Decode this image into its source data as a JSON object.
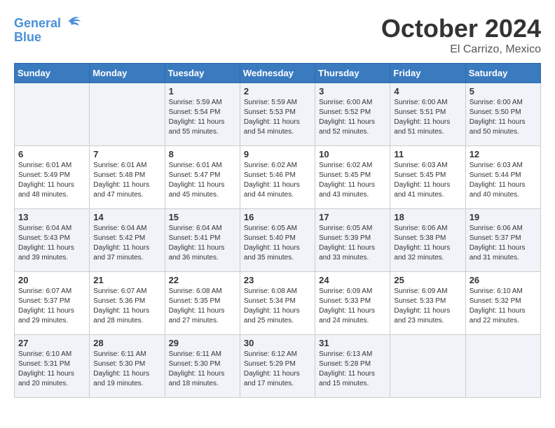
{
  "header": {
    "logo_line1": "General",
    "logo_line2": "Blue",
    "title": "October 2024",
    "subtitle": "El Carrizo, Mexico"
  },
  "days_of_week": [
    "Sunday",
    "Monday",
    "Tuesday",
    "Wednesday",
    "Thursday",
    "Friday",
    "Saturday"
  ],
  "weeks": [
    [
      {
        "day": "",
        "info": ""
      },
      {
        "day": "",
        "info": ""
      },
      {
        "day": "1",
        "info": "Sunrise: 5:59 AM\nSunset: 5:54 PM\nDaylight: 11 hours and 55 minutes."
      },
      {
        "day": "2",
        "info": "Sunrise: 5:59 AM\nSunset: 5:53 PM\nDaylight: 11 hours and 54 minutes."
      },
      {
        "day": "3",
        "info": "Sunrise: 6:00 AM\nSunset: 5:52 PM\nDaylight: 11 hours and 52 minutes."
      },
      {
        "day": "4",
        "info": "Sunrise: 6:00 AM\nSunset: 5:51 PM\nDaylight: 11 hours and 51 minutes."
      },
      {
        "day": "5",
        "info": "Sunrise: 6:00 AM\nSunset: 5:50 PM\nDaylight: 11 hours and 50 minutes."
      }
    ],
    [
      {
        "day": "6",
        "info": "Sunrise: 6:01 AM\nSunset: 5:49 PM\nDaylight: 11 hours and 48 minutes."
      },
      {
        "day": "7",
        "info": "Sunrise: 6:01 AM\nSunset: 5:48 PM\nDaylight: 11 hours and 47 minutes."
      },
      {
        "day": "8",
        "info": "Sunrise: 6:01 AM\nSunset: 5:47 PM\nDaylight: 11 hours and 45 minutes."
      },
      {
        "day": "9",
        "info": "Sunrise: 6:02 AM\nSunset: 5:46 PM\nDaylight: 11 hours and 44 minutes."
      },
      {
        "day": "10",
        "info": "Sunrise: 6:02 AM\nSunset: 5:45 PM\nDaylight: 11 hours and 43 minutes."
      },
      {
        "day": "11",
        "info": "Sunrise: 6:03 AM\nSunset: 5:45 PM\nDaylight: 11 hours and 41 minutes."
      },
      {
        "day": "12",
        "info": "Sunrise: 6:03 AM\nSunset: 5:44 PM\nDaylight: 11 hours and 40 minutes."
      }
    ],
    [
      {
        "day": "13",
        "info": "Sunrise: 6:04 AM\nSunset: 5:43 PM\nDaylight: 11 hours and 39 minutes."
      },
      {
        "day": "14",
        "info": "Sunrise: 6:04 AM\nSunset: 5:42 PM\nDaylight: 11 hours and 37 minutes."
      },
      {
        "day": "15",
        "info": "Sunrise: 6:04 AM\nSunset: 5:41 PM\nDaylight: 11 hours and 36 minutes."
      },
      {
        "day": "16",
        "info": "Sunrise: 6:05 AM\nSunset: 5:40 PM\nDaylight: 11 hours and 35 minutes."
      },
      {
        "day": "17",
        "info": "Sunrise: 6:05 AM\nSunset: 5:39 PM\nDaylight: 11 hours and 33 minutes."
      },
      {
        "day": "18",
        "info": "Sunrise: 6:06 AM\nSunset: 5:38 PM\nDaylight: 11 hours and 32 minutes."
      },
      {
        "day": "19",
        "info": "Sunrise: 6:06 AM\nSunset: 5:37 PM\nDaylight: 11 hours and 31 minutes."
      }
    ],
    [
      {
        "day": "20",
        "info": "Sunrise: 6:07 AM\nSunset: 5:37 PM\nDaylight: 11 hours and 29 minutes."
      },
      {
        "day": "21",
        "info": "Sunrise: 6:07 AM\nSunset: 5:36 PM\nDaylight: 11 hours and 28 minutes."
      },
      {
        "day": "22",
        "info": "Sunrise: 6:08 AM\nSunset: 5:35 PM\nDaylight: 11 hours and 27 minutes."
      },
      {
        "day": "23",
        "info": "Sunrise: 6:08 AM\nSunset: 5:34 PM\nDaylight: 11 hours and 25 minutes."
      },
      {
        "day": "24",
        "info": "Sunrise: 6:09 AM\nSunset: 5:33 PM\nDaylight: 11 hours and 24 minutes."
      },
      {
        "day": "25",
        "info": "Sunrise: 6:09 AM\nSunset: 5:33 PM\nDaylight: 11 hours and 23 minutes."
      },
      {
        "day": "26",
        "info": "Sunrise: 6:10 AM\nSunset: 5:32 PM\nDaylight: 11 hours and 22 minutes."
      }
    ],
    [
      {
        "day": "27",
        "info": "Sunrise: 6:10 AM\nSunset: 5:31 PM\nDaylight: 11 hours and 20 minutes."
      },
      {
        "day": "28",
        "info": "Sunrise: 6:11 AM\nSunset: 5:30 PM\nDaylight: 11 hours and 19 minutes."
      },
      {
        "day": "29",
        "info": "Sunrise: 6:11 AM\nSunset: 5:30 PM\nDaylight: 11 hours and 18 minutes."
      },
      {
        "day": "30",
        "info": "Sunrise: 6:12 AM\nSunset: 5:29 PM\nDaylight: 11 hours and 17 minutes."
      },
      {
        "day": "31",
        "info": "Sunrise: 6:13 AM\nSunset: 5:28 PM\nDaylight: 11 hours and 15 minutes."
      },
      {
        "day": "",
        "info": ""
      },
      {
        "day": "",
        "info": ""
      }
    ]
  ]
}
